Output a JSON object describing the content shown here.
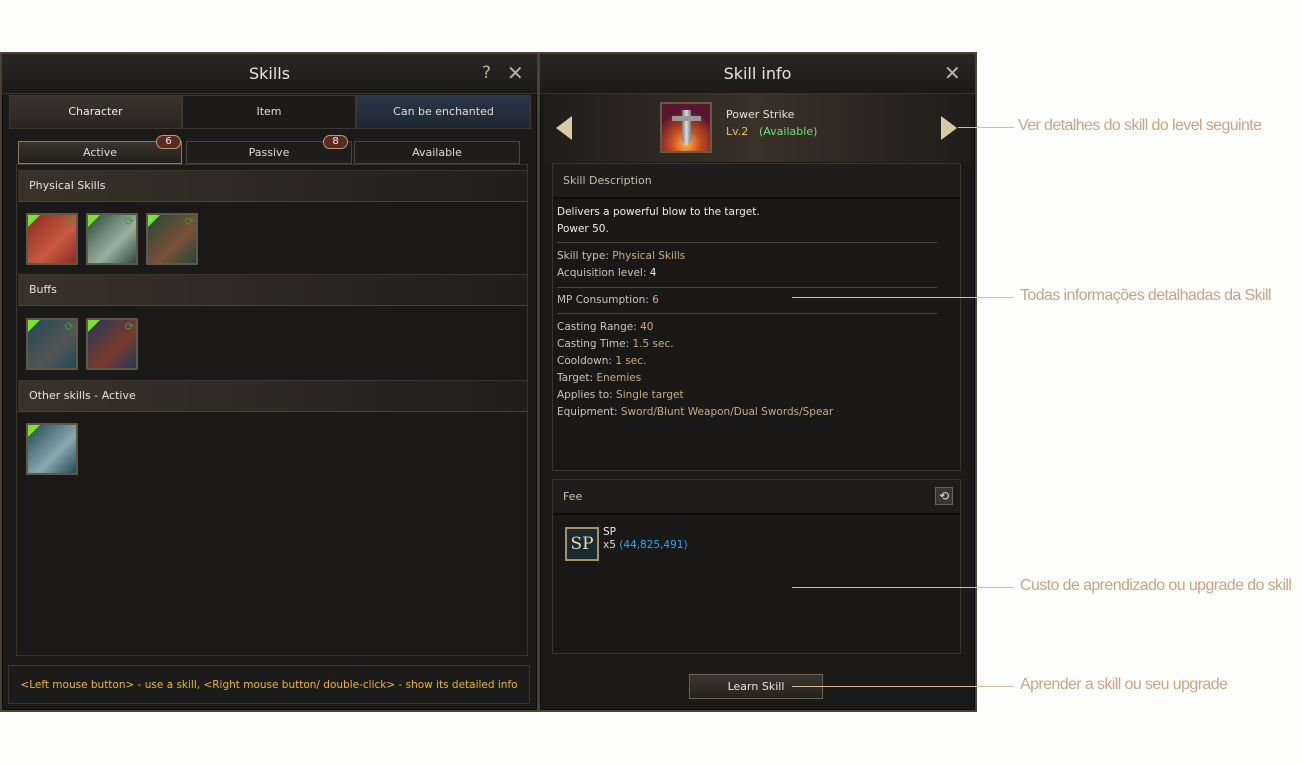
{
  "skills_window": {
    "title": "Skills",
    "help_label": "?",
    "close_label": "✕",
    "tabs": [
      {
        "label": "Character"
      },
      {
        "label": "Item"
      },
      {
        "label": "Can be enchanted"
      }
    ],
    "subtabs": [
      {
        "label": "Active",
        "count": "6"
      },
      {
        "label": "Passive",
        "count": "8"
      },
      {
        "label": "Available"
      }
    ],
    "sections": [
      {
        "title": "Physical Skills",
        "icons": [
          {
            "name": "power-strike-icon",
            "colors": [
              "#8a2a22",
              "#c85a40"
            ]
          },
          {
            "name": "slash-icon",
            "colors": [
              "#2d4a3c",
              "#9ab0a0"
            ]
          },
          {
            "name": "hook-strike-icon",
            "colors": [
              "#24473a",
              "#7a5038"
            ]
          }
        ]
      },
      {
        "title": "Buffs",
        "icons": [
          {
            "name": "shield-cross-icon",
            "colors": [
              "#1f4a55",
              "#555"
            ]
          },
          {
            "name": "hammer-buff-icon",
            "colors": [
              "#223a55",
              "#7a3a30"
            ]
          }
        ]
      },
      {
        "title": "Other skills - Active",
        "icons": [
          {
            "name": "banner-flag-icon",
            "colors": [
              "#1f4a50",
              "#8aa8b0"
            ]
          }
        ]
      }
    ],
    "footer_hint": "<Left mouse button> - use a skill, <Right mouse button/ double-click> - show its detailed info"
  },
  "skill_info": {
    "title": "Skill info",
    "close_label": "✕",
    "skill_name": "Power Strike",
    "level": "Lv.2",
    "status": "(Available)",
    "description_header": "Skill Description",
    "description": [
      "Delivers a powerful blow to the target.",
      "Power 50."
    ],
    "skill_type": {
      "label": "Skill type:",
      "value": "Physical Skills"
    },
    "acquisition_level": {
      "label": "Acquisition level:",
      "value": "4"
    },
    "mp_consumption": {
      "label": "MP Consumption:",
      "value": "6"
    },
    "casting_range": {
      "label": "Casting Range:",
      "value": "40"
    },
    "casting_time": {
      "label": "Casting Time:",
      "value": "1.5 sec."
    },
    "cooldown": {
      "label": "Cooldown:",
      "value": "1 sec."
    },
    "target": {
      "label": "Target:",
      "value": "Enemies"
    },
    "applies_to": {
      "label": "Applies to:",
      "value": "Single target"
    },
    "equipment": {
      "label": "Equipment:",
      "value": "Sword/Blunt Weapon/Dual Swords/Spear"
    },
    "fee_header": "Fee",
    "fee_item": "SP",
    "fee_icon_text": "SP",
    "fee_qty": "x5",
    "fee_owned": "(44,825,491)",
    "learn_button": "Learn Skill"
  },
  "annotations": {
    "next_level": "Ver detalhes do skill do level seguinte",
    "details": "Todas informações detalhadas da Skill",
    "cost": "Custo de aprendizado ou upgrade do skill",
    "learn": "Aprender a skill ou seu upgrade"
  },
  "colors": {
    "level": "#e7c84a",
    "available": "#6ee07a",
    "value": "#c9ac82",
    "owned": "#2ea8f0",
    "hint": "#e7b82f",
    "annotation": "#c8a487"
  }
}
